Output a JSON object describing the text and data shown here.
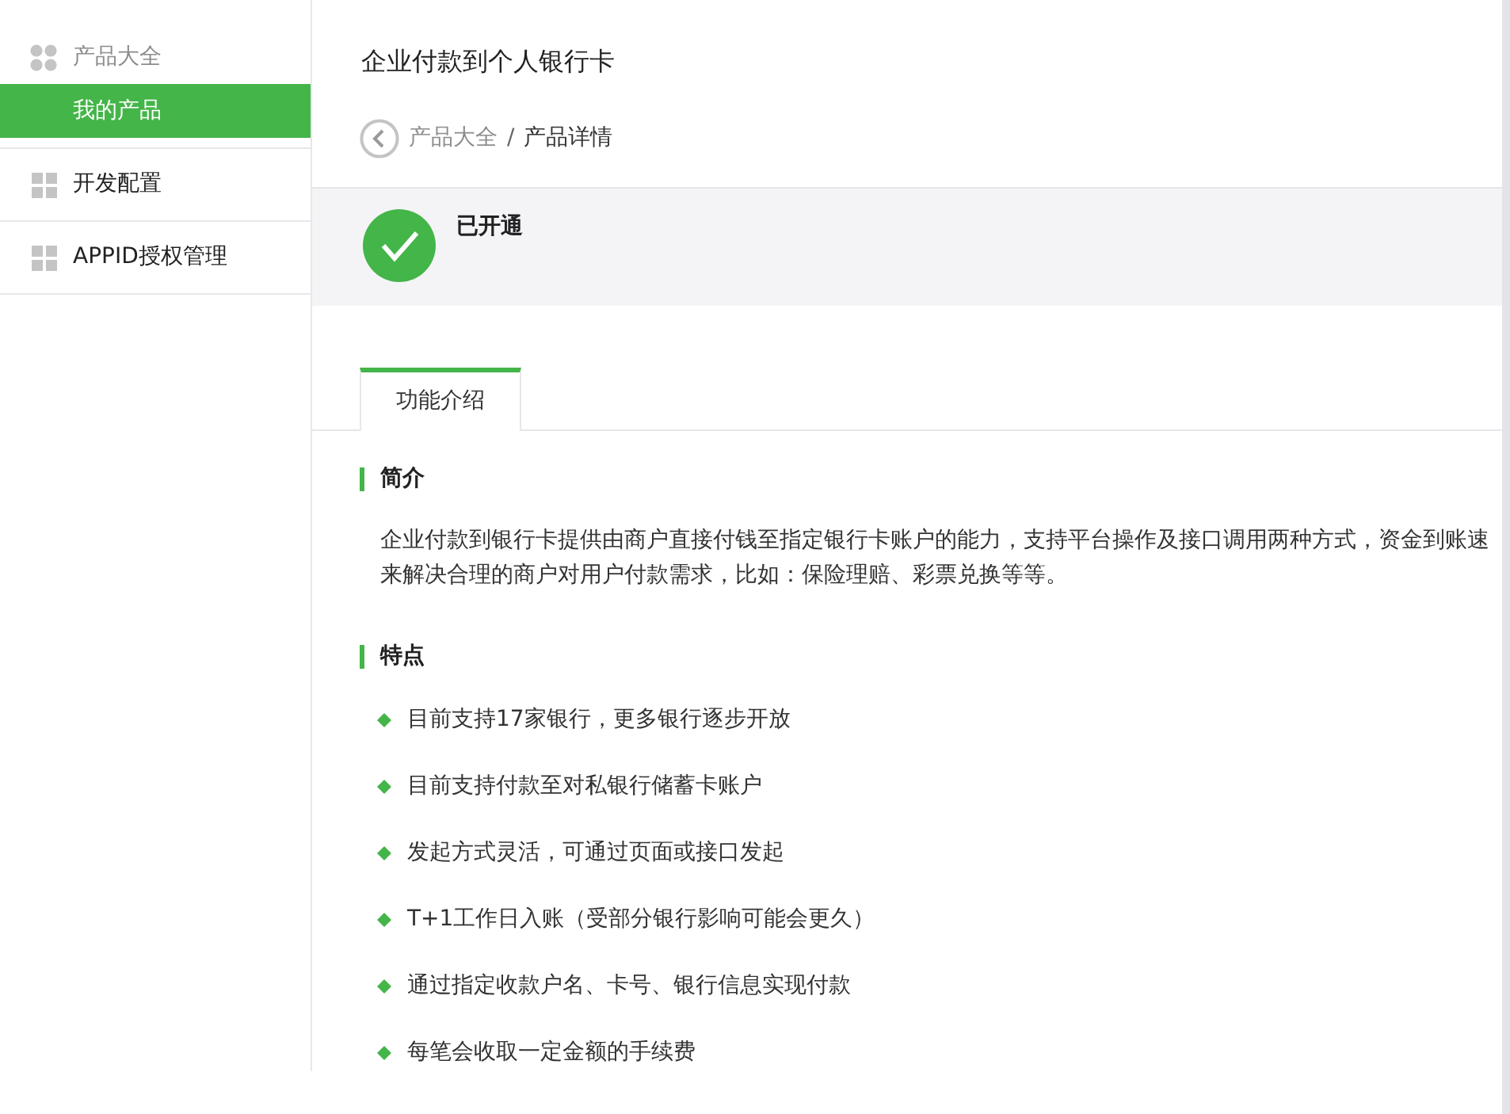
{
  "sidebar": {
    "section": {
      "label": "产品大全",
      "items": [
        {
          "label": "我的产品",
          "selected": true
        }
      ]
    },
    "items": [
      {
        "label": "开发配置",
        "selected": false
      },
      {
        "label": "APPID授权管理",
        "selected": false
      }
    ]
  },
  "page": {
    "title": "企业付款到个人银行卡",
    "breadcrumb_separator": "/",
    "breadcrumb": [
      {
        "label": "产品大全",
        "kind": "link"
      },
      {
        "label": "产品详情",
        "kind": "current"
      }
    ]
  },
  "status": {
    "label": "已开通",
    "enabled": true
  },
  "tabs": [
    {
      "label": "功能介绍",
      "selected": true
    }
  ],
  "intro": {
    "heading": "简介",
    "lines": [
      "企业付款到银行卡提供由商户直接付钱至指定银行卡账户的能力，支持平台操作及接口调用两种方式，资金到账速",
      "来解决合理的商户对用户付款需求，比如：保险理赔、彩票兑换等等。"
    ]
  },
  "features": {
    "heading": "特点",
    "items": [
      "目前支持17家银行，更多银行逐步开放",
      "目前支持付款至对私银行储蓄卡账户",
      "发起方式灵活，可通过页面或接口发起",
      "T+1工作日入账（受部分银行影响可能会更久）",
      "通过指定收款户名、卡号、银行信息实现付款",
      "每笔会收取一定金额的手续费"
    ]
  }
}
